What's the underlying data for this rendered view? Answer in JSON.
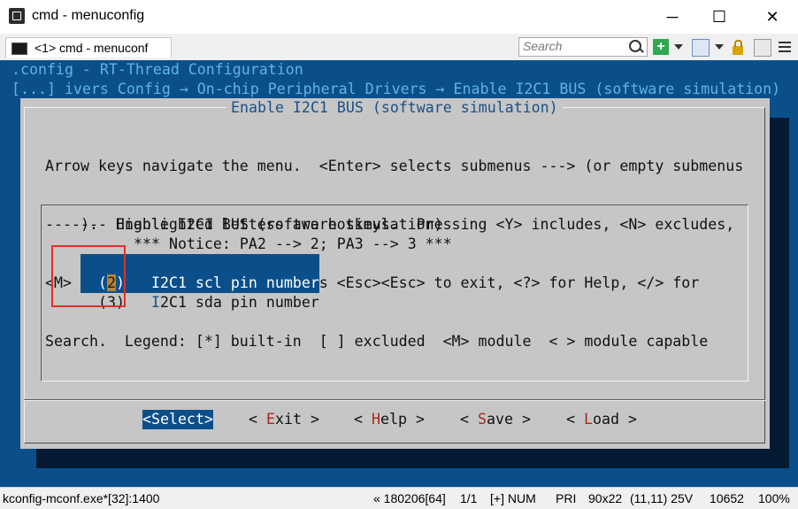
{
  "window": {
    "title": "cmd - menuconfig",
    "minimize_glyph": "─",
    "maximize_glyph": "☐",
    "close_glyph": "✕"
  },
  "tab": {
    "label": "<1> cmd - menuconf"
  },
  "toolbar": {
    "search_placeholder": "Search",
    "icons": [
      "search-icon",
      "add-icon",
      "view-icon",
      "lock-icon",
      "settings-icon",
      "menu-icon"
    ],
    "add_glyph": "+"
  },
  "terminal": {
    "config_line": ".config - RT-Thread Configuration",
    "breadcrumb": "[...] ivers Config → On-chip Peripheral Drivers → Enable I2C1 BUS (software simulation)",
    "dialog_title": "Enable I2C1 BUS (software simulation)",
    "help_lines": [
      "Arrow keys navigate the menu.  <Enter> selects submenus ---> (or empty submenus",
      "----).  Highlighted letters are hotkeys.  Pressing <Y> includes, <N> excludes,",
      "<M> modularizes features.  Press <Esc><Esc> to exit, <?> for Help, </> for",
      "Search.  Legend: [*] built-in  [ ] excluded  <M> module  < > module capable"
    ],
    "menu": {
      "header": "--- Enable I2C1 BUS (software simulation)",
      "notice": "*** Notice: PA2 --> 2; PA3 --> 3 ***",
      "items": [
        {
          "value_open": "(",
          "value": "2",
          "value_close": ")",
          "hotkey": "I",
          "label": "2C1 scl pin number",
          "selected": true
        },
        {
          "value_open": "(",
          "value": "3",
          "value_close": ")",
          "hotkey": "I",
          "label": "2C1 sda pin number",
          "selected": false
        }
      ]
    },
    "buttons": [
      {
        "open": "<",
        "hotkey": "S",
        "rest": "elect",
        "close": ">"
      },
      {
        "open": "< ",
        "hotkey": "E",
        "rest": "xit",
        "close": " >"
      },
      {
        "open": "< ",
        "hotkey": "H",
        "rest": "elp",
        "close": " >"
      },
      {
        "open": "< ",
        "hotkey": "S",
        "rest": "ave",
        "close": " >"
      },
      {
        "open": "< ",
        "hotkey": "L",
        "rest": "oad",
        "close": " >"
      }
    ]
  },
  "statusbar": {
    "process": "kconfig-mconf.exe*[32]:1400",
    "position": "« 180206[64]",
    "pages": "1/1",
    "mode": "[+] NUM",
    "pri": "PRI",
    "size": "90x22",
    "cursor": "(11,11) 25V",
    "pid": "10652",
    "zoom": "100%"
  },
  "colors": {
    "terminal_bg": "#0b4f8a",
    "dialog_bg": "#c6c6c6",
    "selection_bg": "#0b4f8a",
    "hotkey_red": "#a8281d",
    "highlight_box": "#e0302a"
  }
}
